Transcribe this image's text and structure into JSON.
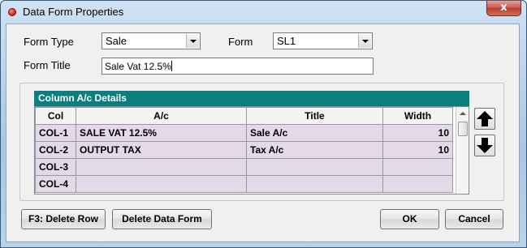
{
  "window": {
    "title": "Data Form Properties",
    "close_label": "x"
  },
  "form": {
    "form_type_label": "Form Type",
    "form_type_value": "Sale",
    "form_label": "Form",
    "form_value": "SL1",
    "form_title_label": "Form Title",
    "form_title_value": "Sale Vat 12.5%"
  },
  "grid": {
    "caption": "Column A/c Details",
    "columns": [
      "Col",
      "A/c",
      "Title",
      "Width"
    ],
    "rows": [
      {
        "col": "COL-1",
        "ac": "SALE VAT 12.5%",
        "title": "Sale A/c",
        "width": "10"
      },
      {
        "col": "COL-2",
        "ac": "OUTPUT TAX",
        "title": "Tax A/c",
        "width": "10"
      },
      {
        "col": "COL-3",
        "ac": "",
        "title": "",
        "width": ""
      },
      {
        "col": "COL-4",
        "ac": "",
        "title": "",
        "width": ""
      }
    ]
  },
  "buttons": {
    "delete_row": "F3: Delete Row",
    "delete_form": "Delete Data Form",
    "ok": "OK",
    "cancel": "Cancel"
  },
  "colors": {
    "grid_header_bg": "#0b7e7e",
    "cell_bg": "#e3d9e8"
  }
}
